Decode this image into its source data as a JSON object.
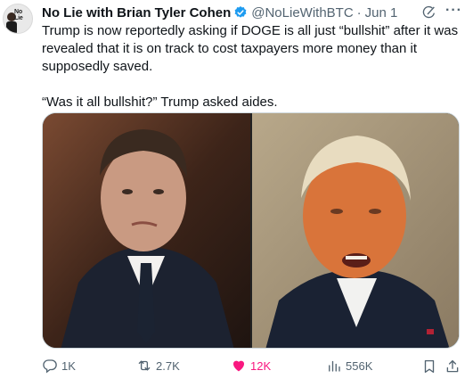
{
  "author": {
    "name": "No Lie with Brian Tyler Cohen",
    "handle": "@NoLieWithBTC",
    "separator": "·",
    "date": "Jun 1",
    "avatar_text": "No Lie"
  },
  "tweet": {
    "text": "Trump is now reportedly asking if DOGE is all just “bullshit” after it was revealed that it is on track to cost taxpayers more money than it supposedly saved.\n\n“Was it all bullshit?” Trump asked aides."
  },
  "actions": {
    "replies": "1K",
    "reposts": "2.7K",
    "likes": "12K",
    "views": "556K"
  },
  "colors": {
    "verified": "#1d9bf0",
    "like": "#f91880",
    "muted": "#536471"
  }
}
